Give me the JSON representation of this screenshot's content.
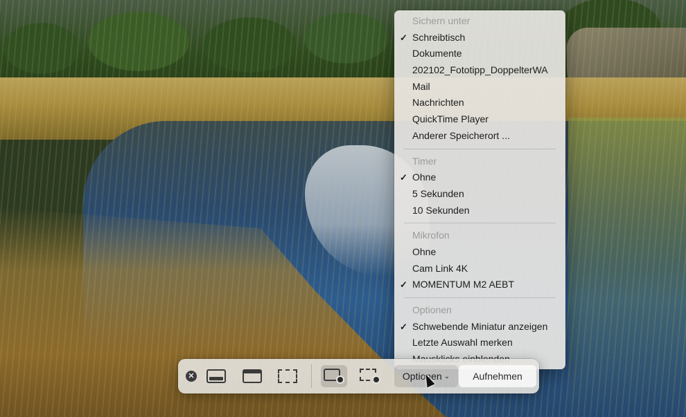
{
  "toolbar": {
    "close_icon": "x-circle-icon",
    "tools": [
      {
        "name": "capture-entire-screen",
        "icon": "screen-full-icon"
      },
      {
        "name": "capture-window",
        "icon": "screen-window-icon"
      },
      {
        "name": "capture-selection",
        "icon": "screen-dashed-icon"
      },
      {
        "name": "record-entire-screen",
        "icon": "record-screen-icon",
        "selected": true
      },
      {
        "name": "record-selection",
        "icon": "record-selection-icon"
      }
    ],
    "options_label": "Optionen",
    "options_chevron": "chevron-down-icon",
    "record_label": "Aufnehmen"
  },
  "menu": {
    "save_header": "Sichern unter",
    "save_items": [
      {
        "label": "Schreibtisch",
        "checked": true
      },
      {
        "label": "Dokumente",
        "checked": false
      },
      {
        "label": "202102_Fototipp_DoppelterWA",
        "checked": false
      },
      {
        "label": "Mail",
        "checked": false
      },
      {
        "label": "Nachrichten",
        "checked": false
      },
      {
        "label": "QuickTime Player",
        "checked": false
      },
      {
        "label": "Anderer Speicherort ...",
        "checked": false
      }
    ],
    "timer_header": "Timer",
    "timer_items": [
      {
        "label": "Ohne",
        "checked": true
      },
      {
        "label": "5 Sekunden",
        "checked": false
      },
      {
        "label": "10 Sekunden",
        "checked": false
      }
    ],
    "mic_header": "Mikrofon",
    "mic_items": [
      {
        "label": "Ohne",
        "checked": false
      },
      {
        "label": "Cam Link 4K",
        "checked": false
      },
      {
        "label": "MOMENTUM M2 AEBT",
        "checked": true
      }
    ],
    "options_header": "Optionen",
    "options_items": [
      {
        "label": "Schwebende Miniatur anzeigen",
        "checked": true
      },
      {
        "label": "Letzte Auswahl merken",
        "checked": false
      },
      {
        "label": "Mausklicks einblenden",
        "checked": false
      }
    ],
    "check_glyph": "✓"
  }
}
